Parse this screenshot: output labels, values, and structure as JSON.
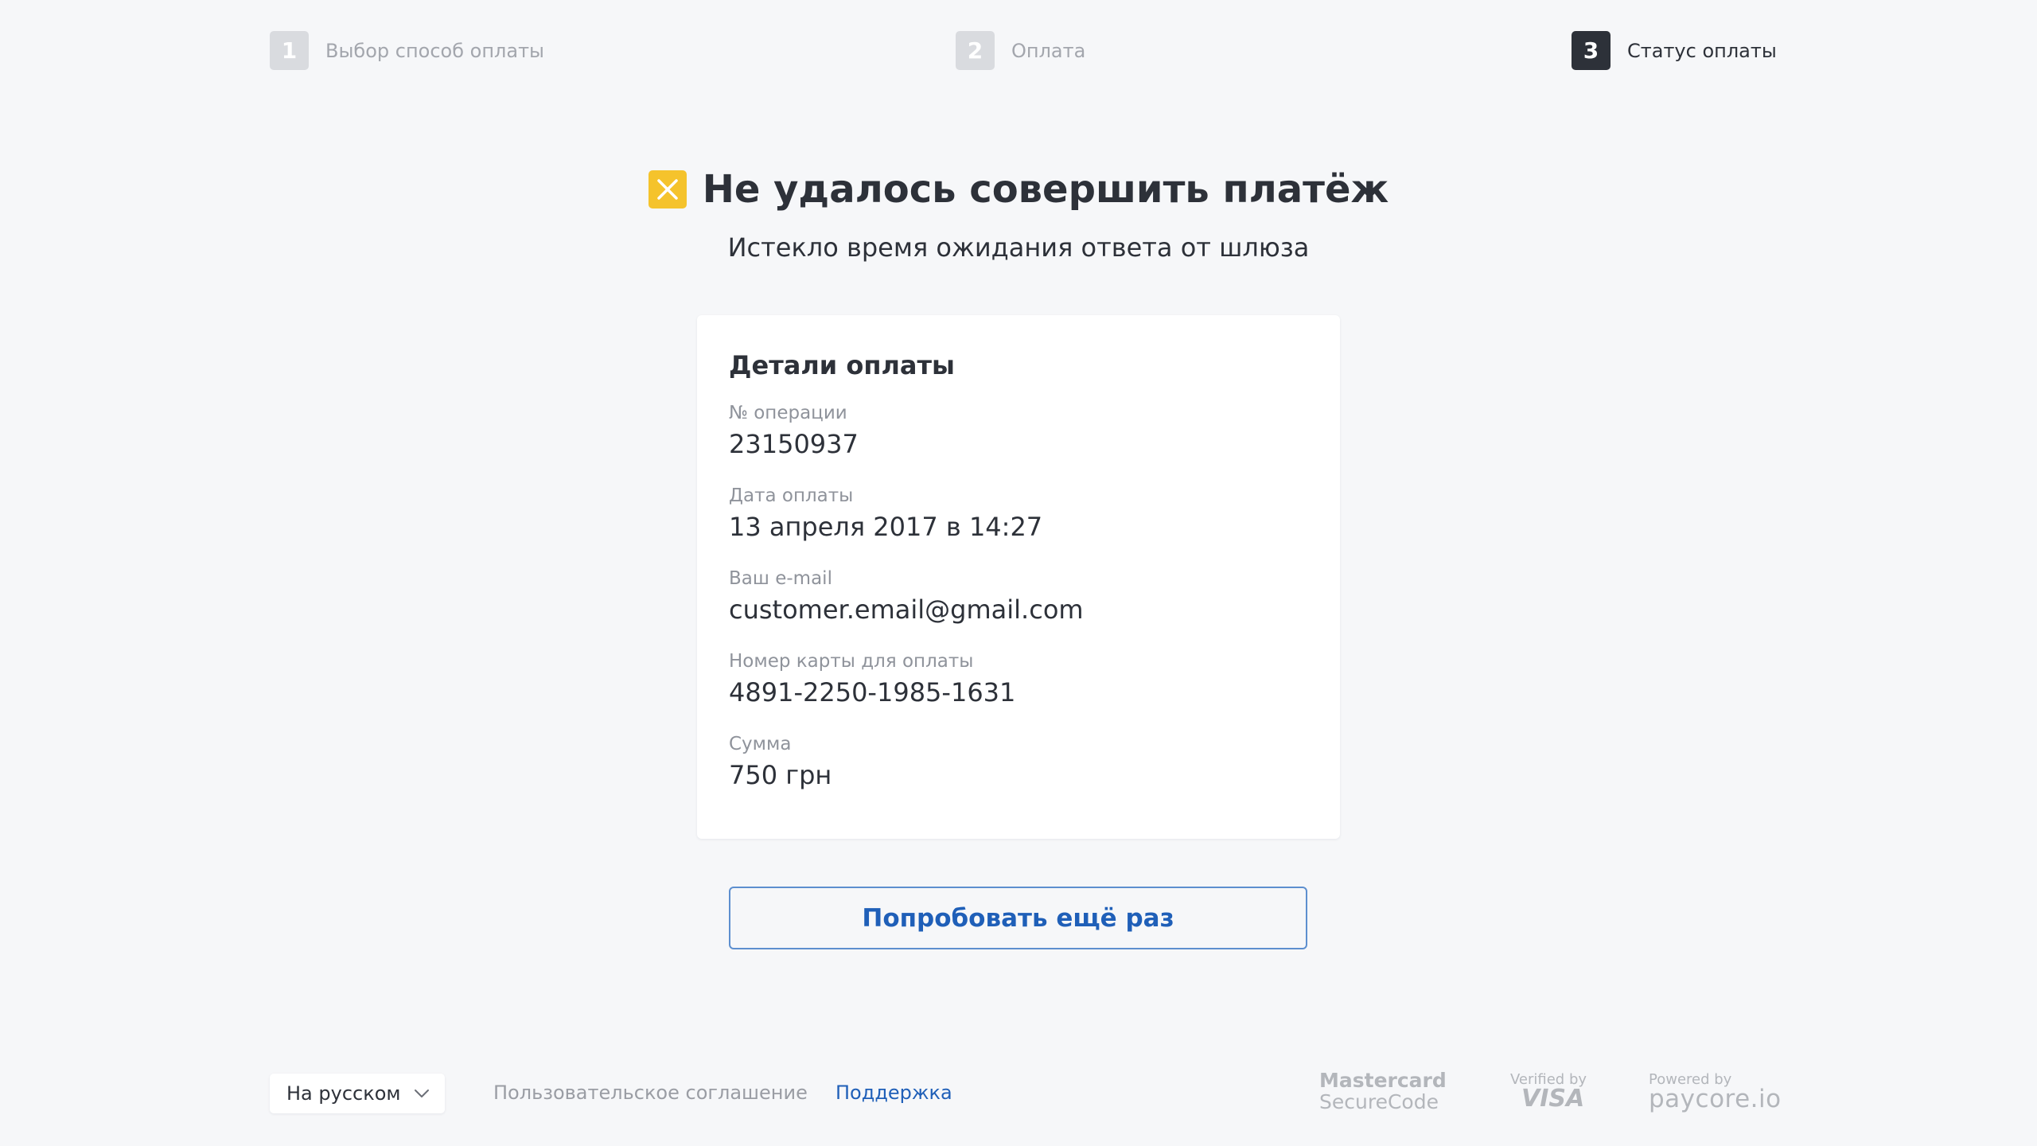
{
  "steps": [
    {
      "number": "1",
      "label": "Выбор способ оплаты",
      "state": "inactive"
    },
    {
      "number": "2",
      "label": "Оплата",
      "state": "inactive"
    },
    {
      "number": "3",
      "label": "Статус оплаты",
      "state": "active"
    }
  ],
  "status": {
    "icon": "close-icon",
    "icon_color": "#f5c32c",
    "title": "Не удалось совершить платёж",
    "subtitle": "Истекло время ожидания ответа от шлюза"
  },
  "details": {
    "title": "Детали оплаты",
    "items": [
      {
        "label": "№ операции",
        "value": "23150937"
      },
      {
        "label": "Дата оплаты",
        "value": "13 апреля 2017 в 14:27"
      },
      {
        "label": "Ваш e-mail",
        "value": "customer.email@gmail.com"
      },
      {
        "label": "Номер карты для оплаты",
        "value": "4891-2250-1985-1631"
      },
      {
        "label": "Сумма",
        "value": "750 грн"
      }
    ]
  },
  "retry_button": {
    "label": "Попробовать ещё раз"
  },
  "footer": {
    "language": "На русском",
    "terms_link": "Пользовательское соглашение",
    "support_link": "Поддержка",
    "badges": {
      "mastercard_line1": "Mastercard",
      "mastercard_line2": "SecureCode",
      "visa_line1": "Verified by",
      "visa_line2": "VISA",
      "paycore_line1": "Powered by",
      "paycore_line2": "paycore.io"
    }
  },
  "colors": {
    "accent": "#1f5fb8",
    "warning": "#f5c32c",
    "background": "#f6f7f9",
    "active_step": "#2d3139",
    "inactive_step": "#d9dbdf"
  }
}
